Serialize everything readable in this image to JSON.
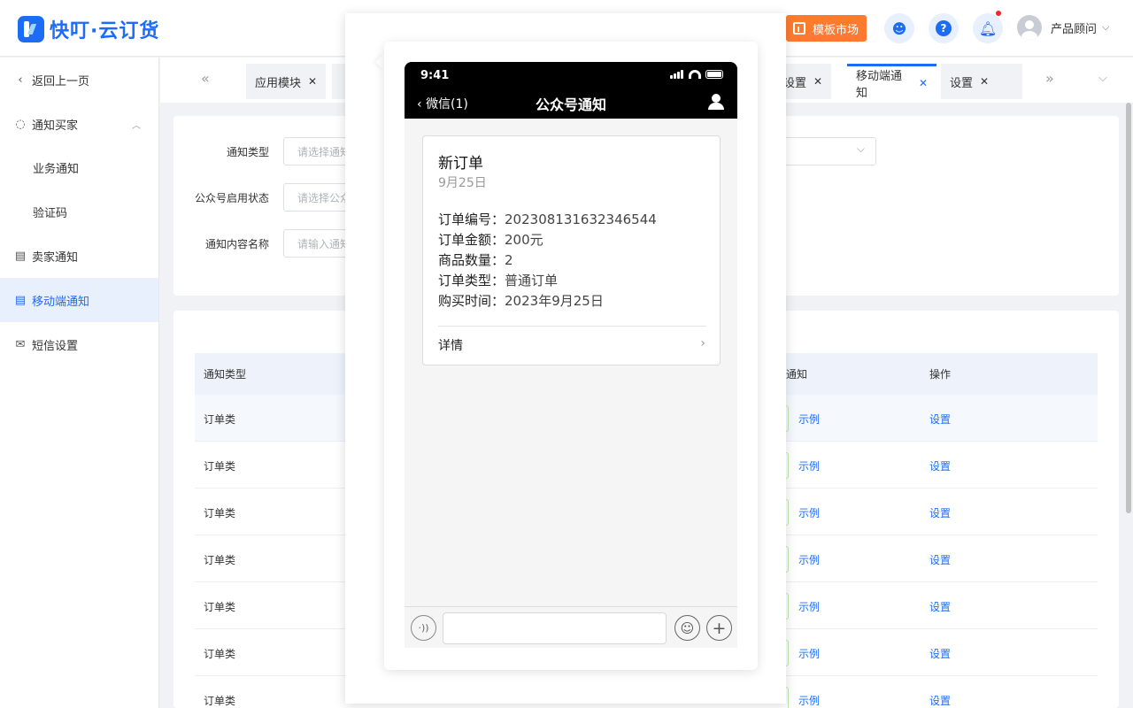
{
  "header": {
    "logo_text": "快叮·云订货",
    "market_label": "模板市场",
    "user_name": "产品顾问",
    "brand_color": "#1d6cf6",
    "market_color": "#ff7a2f"
  },
  "sidebar": {
    "back_label": "返回上一页",
    "items": [
      {
        "label": "通知买家"
      },
      {
        "label": "业务通知"
      },
      {
        "label": "验证码"
      },
      {
        "label": "卖家通知"
      },
      {
        "label": "移动端通知"
      },
      {
        "label": "短信设置"
      }
    ]
  },
  "tabs": [
    {
      "label": "应用模块"
    },
    {
      "label": "设置"
    },
    {
      "label": "移动端通知"
    },
    {
      "label": "设置"
    }
  ],
  "filters": {
    "type_label": "通知类型",
    "type_placeholder": "请选择通知",
    "status_label": "公众号启用状态",
    "status_placeholder": "请选择公众",
    "name_label": "通知内容名称",
    "name_placeholder": "请输入通知"
  },
  "table": {
    "headers": {
      "type": "通知类型",
      "notify": "通知",
      "action": "操作"
    },
    "rows": [
      {
        "type": "订单类",
        "example": "示例",
        "action": "设置"
      },
      {
        "type": "订单类",
        "example": "示例",
        "action": "设置"
      },
      {
        "type": "订单类",
        "example": "示例",
        "action": "设置"
      },
      {
        "type": "订单类",
        "example": "示例",
        "action": "设置"
      },
      {
        "type": "订单类",
        "example": "示例",
        "action": "设置"
      },
      {
        "type": "订单类",
        "example": "示例",
        "action": "设置"
      },
      {
        "type": "订单类",
        "example": "示例",
        "action": "设置"
      }
    ]
  },
  "phone": {
    "time": "9:41",
    "back_label": "微信(1)",
    "title": "公众号通知",
    "message": {
      "title": "新订单",
      "date": "9月25日",
      "fields": [
        {
          "key": "订单编号：",
          "value": "202308131632346544"
        },
        {
          "key": "订单金额：",
          "value": "200元"
        },
        {
          "key": "商品数量：",
          "value": "2"
        },
        {
          "key": "订单类型：",
          "value": "普通订单"
        },
        {
          "key": "购买时间：",
          "value": "2023年9月25日"
        }
      ],
      "detail_label": "详情"
    }
  }
}
